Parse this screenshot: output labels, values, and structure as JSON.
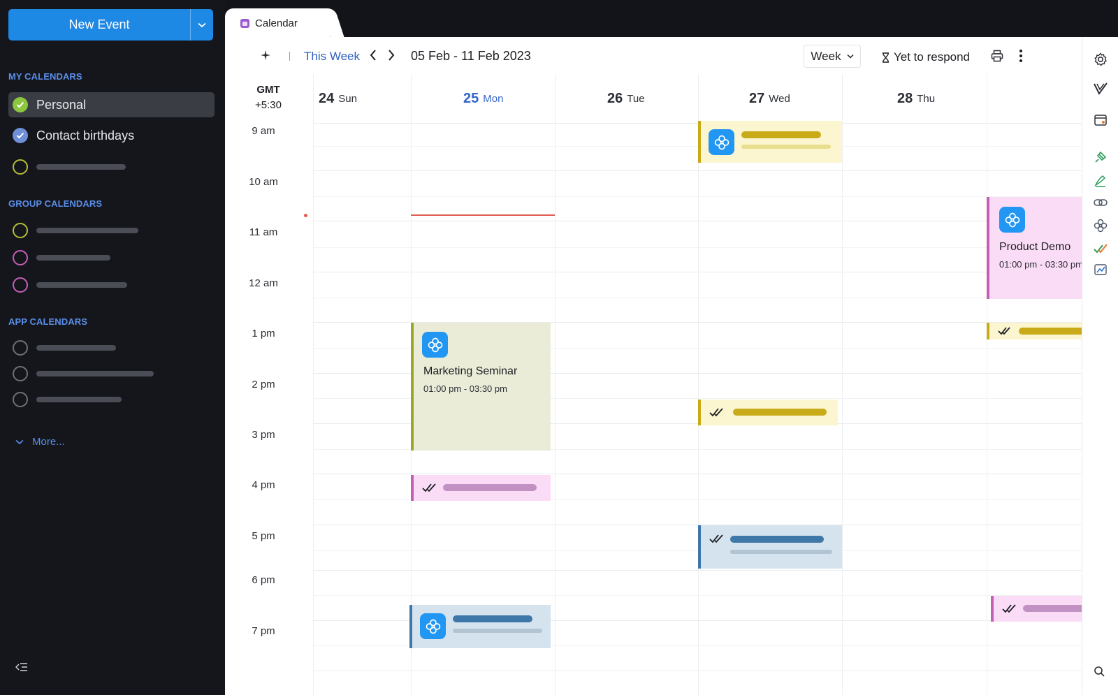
{
  "sidebar": {
    "new_event_label": "New Event",
    "sections": {
      "my_calendars": "MY CALENDARS",
      "group_calendars": "GROUP CALENDARS",
      "app_calendars": "APP CALENDARS"
    },
    "my_calendars": [
      {
        "label": "Personal",
        "color": "#8cc63f",
        "checked": true,
        "active": true
      },
      {
        "label": "Contact birthdays",
        "color": "#6f8fd8",
        "checked": true,
        "active": false
      }
    ],
    "more_label": "More..."
  },
  "tab": {
    "label": "Calendar"
  },
  "toolbar": {
    "this_week": "This Week",
    "date_range": "05 Feb - 11 Feb 2023",
    "view": "Week",
    "yet_to_respond": "Yet to respond"
  },
  "grid": {
    "timezone_label": "GMT",
    "timezone_offset": "+5:30",
    "days": [
      {
        "num": "24",
        "name": "Sun"
      },
      {
        "num": "25",
        "name": "Mon",
        "today": true
      },
      {
        "num": "26",
        "name": "Tue"
      },
      {
        "num": "27",
        "name": "Wed"
      },
      {
        "num": "28",
        "name": "Thu"
      }
    ],
    "hours": [
      "9 am",
      "10 am",
      "11 am",
      "12 am",
      "1 pm",
      "2 pm",
      "3 pm",
      "4 pm",
      "5 pm",
      "6 pm",
      "7 pm"
    ]
  },
  "events": {
    "marketing_seminar": {
      "title": "Marketing Seminar",
      "time": "01:00 pm - 03:30 pm"
    },
    "product_demo": {
      "title": "Product Demo",
      "time": "01:00 pm - 03:30 pm"
    }
  },
  "colors": {
    "accent": "#1e88e5",
    "olive_border": "#9aa82a",
    "olive_bg": "#eaecd8",
    "pink_border": "#c45fb6",
    "pink_bg": "#fbdcf6",
    "yellow_border": "#c9ab1a",
    "yellow_bg": "#fbf6cf",
    "blue_border": "#3d78a8",
    "blue_bg": "#d5e3ee"
  }
}
